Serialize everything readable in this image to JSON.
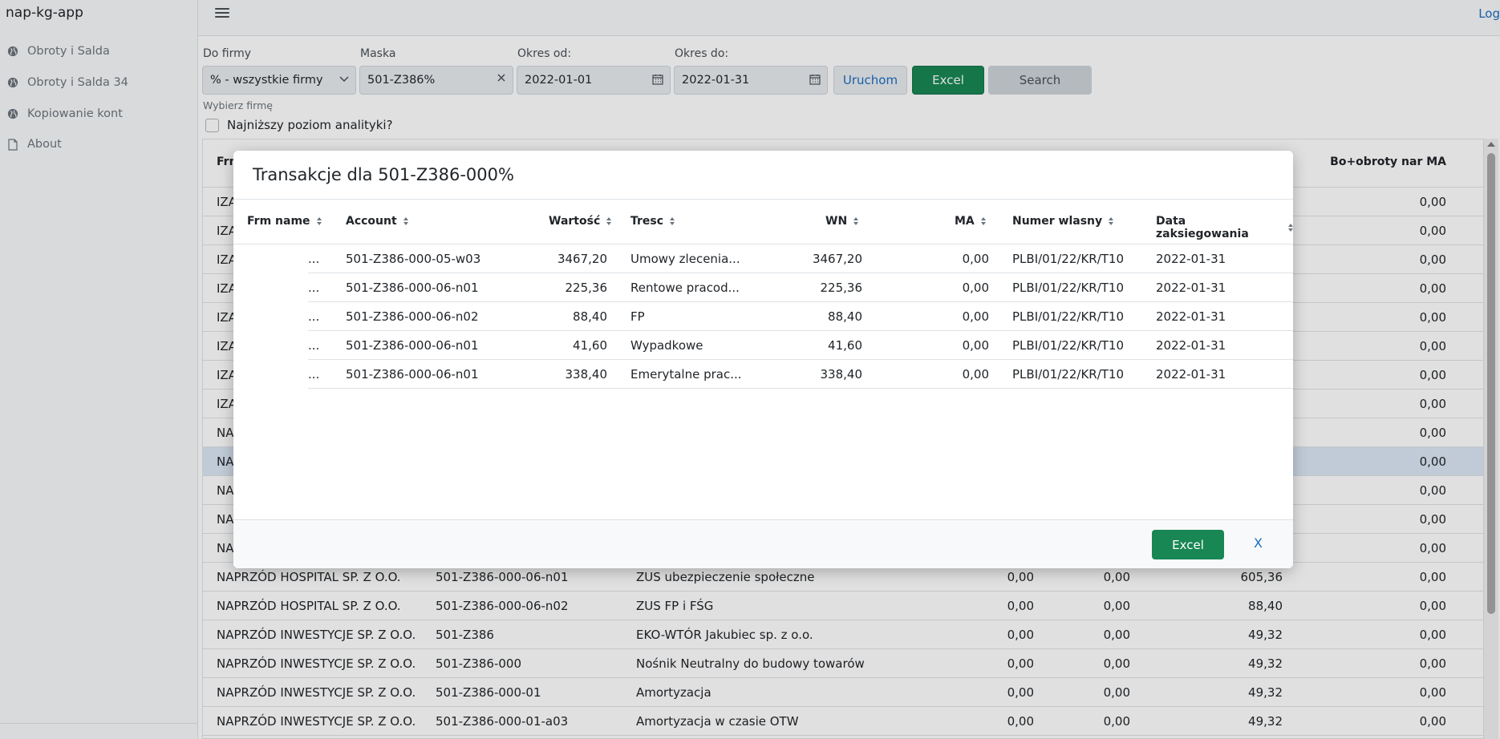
{
  "app": {
    "brand": "nap-kg-app",
    "logout": "Log"
  },
  "sidebar": {
    "items": [
      {
        "label": "Obroty i Salda",
        "icon": "globe-icon"
      },
      {
        "label": "Obroty i Salda 34",
        "icon": "globe-icon"
      },
      {
        "label": "Kopiowanie kont",
        "icon": "globe-icon"
      },
      {
        "label": "About",
        "icon": "document-icon"
      }
    ]
  },
  "form": {
    "company_label": "Do firmy",
    "company_value": "% - wszystkie firmy",
    "mask_label": "Maska",
    "mask_value": "501-Z386%",
    "from_label": "Okres od:",
    "from_value": "2022-01-01",
    "to_label": "Okres do:",
    "to_value": "2022-01-31",
    "run_button": "Uruchom",
    "excel_button": "Excel",
    "search_button": "Search",
    "hint": "Wybierz firmę",
    "checkbox_label": "Najniższy poziom analityki?"
  },
  "table": {
    "header_first": "Frm",
    "header_last": "Bo+obroty nar MA",
    "rows": [
      {
        "firm": "IZA",
        "account": "",
        "desc": "",
        "v1": "",
        "v2": "",
        "v3": "",
        "v4": "0,00"
      },
      {
        "firm": "IZA",
        "account": "",
        "desc": "",
        "v1": "",
        "v2": "",
        "v3": "",
        "v4": "0,00"
      },
      {
        "firm": "IZA",
        "account": "",
        "desc": "",
        "v1": "",
        "v2": "",
        "v3": "",
        "v4": "0,00"
      },
      {
        "firm": "IZA",
        "account": "",
        "desc": "",
        "v1": "",
        "v2": "",
        "v3": "",
        "v4": "0,00"
      },
      {
        "firm": "IZA",
        "account": "",
        "desc": "",
        "v1": "",
        "v2": "",
        "v3": "",
        "v4": "0,00"
      },
      {
        "firm": "IZA",
        "account": "",
        "desc": "",
        "v1": "",
        "v2": "",
        "v3": "",
        "v4": "0,00"
      },
      {
        "firm": "IZA",
        "account": "",
        "desc": "",
        "v1": "",
        "v2": "",
        "v3": "",
        "v4": "0,00"
      },
      {
        "firm": "IZA",
        "account": "",
        "desc": "",
        "v1": "",
        "v2": "",
        "v3": "",
        "v4": "0,00"
      },
      {
        "firm": "NA",
        "account": "",
        "desc": "",
        "v1": "",
        "v2": "",
        "v3": "",
        "v4": "0,00"
      },
      {
        "firm": "NA",
        "account": "",
        "desc": "",
        "v1": "",
        "v2": "",
        "v3": "",
        "v4": "0,00"
      },
      {
        "firm": "NA",
        "account": "",
        "desc": "",
        "v1": "",
        "v2": "",
        "v3": "",
        "v4": "0,00"
      },
      {
        "firm": "NA",
        "account": "",
        "desc": "",
        "v1": "",
        "v2": "",
        "v3": "",
        "v4": "0,00"
      },
      {
        "firm": "NA",
        "account": "",
        "desc": "",
        "v1": "",
        "v2": "",
        "v3": "",
        "v4": "0,00"
      },
      {
        "firm": "NAPRZÓD HOSPITAL SP. Z O.O.",
        "account": "501-Z386-000-06-n01",
        "desc": "ZUS ubezpieczenie społeczne",
        "v1": "0,00",
        "v2": "0,00",
        "v3": "605,36",
        "v4": "0,00"
      },
      {
        "firm": "NAPRZÓD HOSPITAL SP. Z O.O.",
        "account": "501-Z386-000-06-n02",
        "desc": "ZUS FP i FŚG",
        "v1": "0,00",
        "v2": "0,00",
        "v3": "88,40",
        "v4": "0,00"
      },
      {
        "firm": "NAPRZÓD INWESTYCJE SP. Z O.O.",
        "account": "501-Z386",
        "desc": "EKO-WTÓR Jakubiec sp. z o.o.",
        "v1": "0,00",
        "v2": "0,00",
        "v3": "49,32",
        "v4": "0,00"
      },
      {
        "firm": "NAPRZÓD INWESTYCJE SP. Z O.O.",
        "account": "501-Z386-000",
        "desc": "Nośnik Neutralny do budowy towarów",
        "v1": "0,00",
        "v2": "0,00",
        "v3": "49,32",
        "v4": "0,00"
      },
      {
        "firm": "NAPRZÓD INWESTYCJE SP. Z O.O.",
        "account": "501-Z386-000-01",
        "desc": "Amortyzacja",
        "v1": "0,00",
        "v2": "0,00",
        "v3": "49,32",
        "v4": "0,00"
      },
      {
        "firm": "NAPRZÓD INWESTYCJE SP. Z O.O.",
        "account": "501-Z386-000-01-a03",
        "desc": "Amortyzacja w czasie OTW",
        "v1": "0,00",
        "v2": "0,00",
        "v3": "49,32",
        "v4": "0,00"
      }
    ]
  },
  "modal": {
    "title": "Transakcje dla 501-Z386-000%",
    "columns": [
      "Frm name",
      "Account",
      "Wartość",
      "Tresc",
      "WN",
      "MA",
      "Numer wlasny",
      "Data zaksiegowania"
    ],
    "rows": [
      {
        "frm": "...",
        "account": "501-Z386-000-05-w03",
        "value": "3467,20",
        "tresc": "Umowy zlecenia...",
        "wn": "3467,20",
        "ma": "0,00",
        "numer": "PLBI/01/22/KR/T10",
        "data": "2022-01-31"
      },
      {
        "frm": "...",
        "account": "501-Z386-000-06-n01",
        "value": "225,36",
        "tresc": "Rentowe pracod...",
        "wn": "225,36",
        "ma": "0,00",
        "numer": "PLBI/01/22/KR/T10",
        "data": "2022-01-31"
      },
      {
        "frm": "...",
        "account": "501-Z386-000-06-n02",
        "value": "88,40",
        "tresc": "FP",
        "wn": "88,40",
        "ma": "0,00",
        "numer": "PLBI/01/22/KR/T10",
        "data": "2022-01-31"
      },
      {
        "frm": "...",
        "account": "501-Z386-000-06-n01",
        "value": "41,60",
        "tresc": "Wypadkowe",
        "wn": "41,60",
        "ma": "0,00",
        "numer": "PLBI/01/22/KR/T10",
        "data": "2022-01-31"
      },
      {
        "frm": "...",
        "account": "501-Z386-000-06-n01",
        "value": "338,40",
        "tresc": "Emerytalne prac...",
        "wn": "338,40",
        "ma": "0,00",
        "numer": "PLBI/01/22/KR/T10",
        "data": "2022-01-31"
      }
    ],
    "excel_button": "Excel",
    "close_button": "X"
  }
}
